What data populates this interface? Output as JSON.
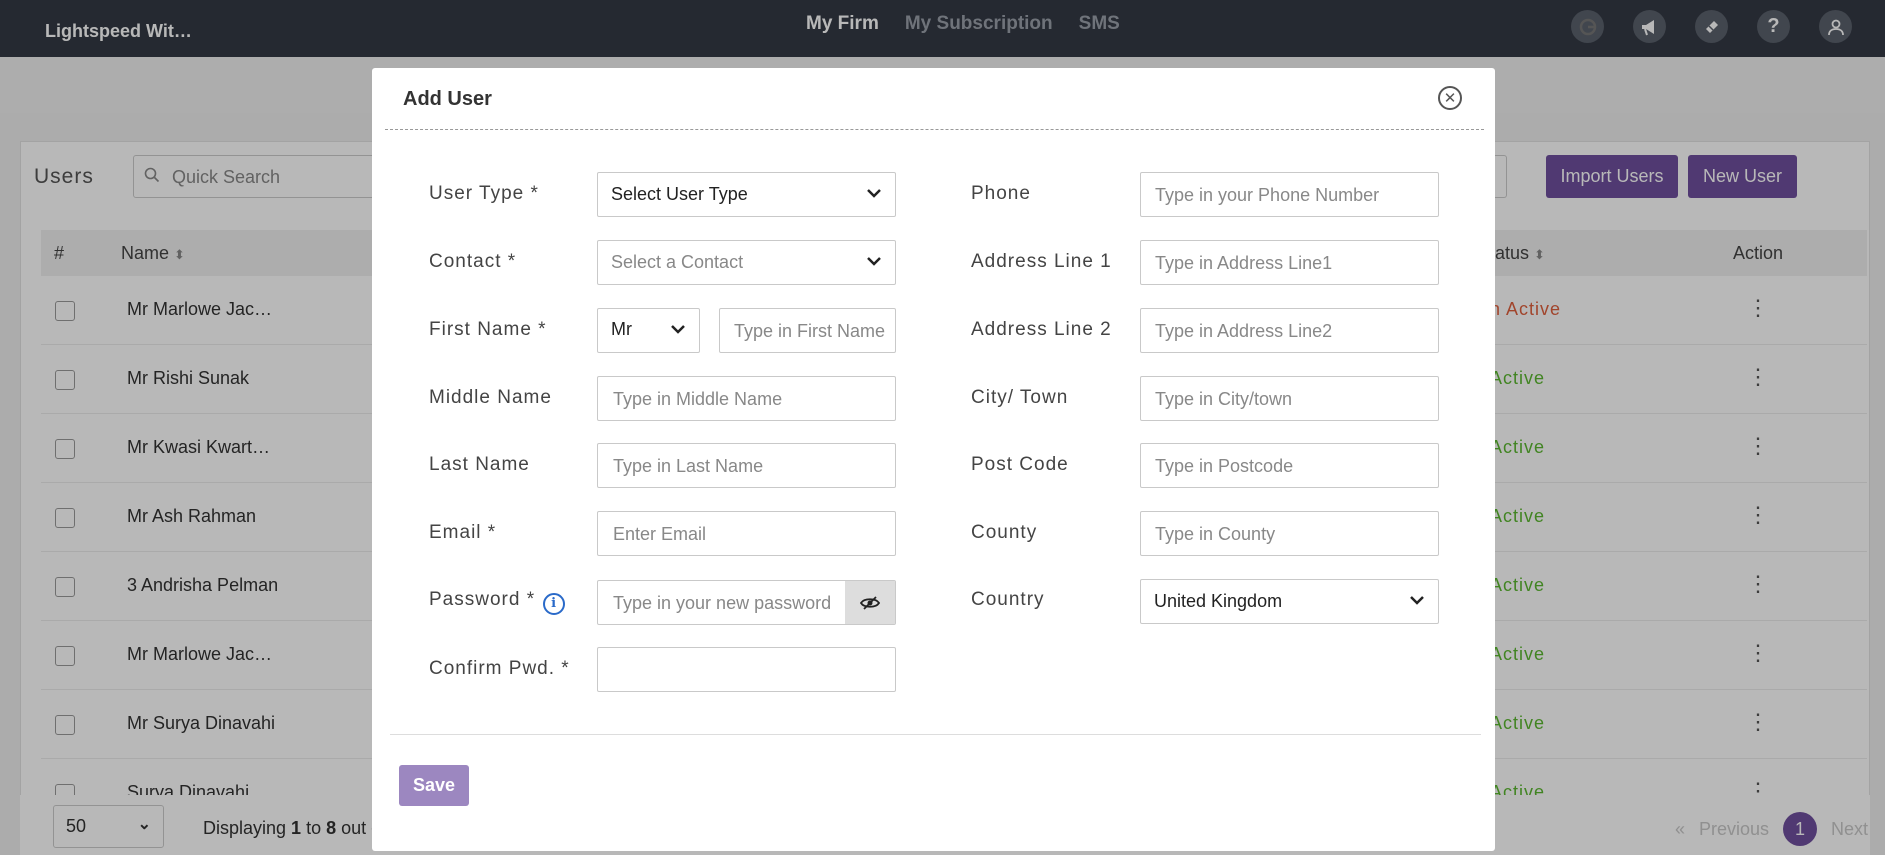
{
  "topbar": {
    "brand": "Lightspeed Wit…",
    "nav": [
      "My Firm",
      "My Subscription",
      "SMS"
    ],
    "icons": [
      "google-icon",
      "megaphone-icon",
      "ticket-icon",
      "help-icon",
      "user-icon"
    ]
  },
  "users_page": {
    "title": "Users",
    "search_placeholder": "Quick Search",
    "import_button": "Import Users",
    "new_button": "New User",
    "columns": {
      "num": "#",
      "name": "Name",
      "status": "tatus",
      "action": "Action"
    },
    "rows": [
      {
        "name": "Mr Marlowe Jac…",
        "status": "n Active",
        "status_color": "#e0603e"
      },
      {
        "name": "Mr Rishi Sunak",
        "status": "Active",
        "status_color": "#5bb830"
      },
      {
        "name": "Mr Kwasi Kwart…",
        "status": "Active",
        "status_color": "#5bb830"
      },
      {
        "name": "Mr Ash Rahman",
        "status": "Active",
        "status_color": "#5bb830"
      },
      {
        "name": "3 Andrisha Pelman",
        "status": "Active",
        "status_color": "#5bb830"
      },
      {
        "name": "Mr Marlowe Jac…",
        "status": "Active",
        "status_color": "#5bb830"
      },
      {
        "name": "Mr Surya Dinavahi",
        "status": "Active",
        "status_color": "#5bb830"
      },
      {
        "name": "Surya Dinavahi",
        "status": "Active",
        "status_color": "#5bb830"
      }
    ],
    "page_size": "50",
    "displaying": {
      "prefix": "Displaying ",
      "from": "1",
      "mid": " to ",
      "to": "8",
      "suffix": " out o"
    },
    "pager": {
      "first": "«",
      "previous": "Previous",
      "current": "1",
      "next": "Next"
    }
  },
  "modal": {
    "title": "Add User",
    "left_fields": {
      "user_type": {
        "label": "User Type *",
        "value": "Select User Type"
      },
      "contact": {
        "label": "Contact *",
        "placeholder": "Select a Contact"
      },
      "first_name": {
        "label": "First Name *",
        "title_value": "Mr",
        "placeholder": "Type in First Name"
      },
      "middle_name": {
        "label": "Middle Name",
        "placeholder": "Type in Middle Name"
      },
      "last_name": {
        "label": "Last Name",
        "placeholder": "Type in Last Name"
      },
      "email": {
        "label": "Email *",
        "placeholder": "Enter Email"
      },
      "password": {
        "label": "Password *",
        "placeholder": "Type in your new password"
      },
      "confirm": {
        "label": "Confirm Pwd. *",
        "placeholder": ""
      }
    },
    "right_fields": {
      "phone": {
        "label": "Phone",
        "placeholder": "Type in your Phone Number"
      },
      "address1": {
        "label": "Address Line 1",
        "placeholder": "Type in Address Line1"
      },
      "address2": {
        "label": "Address Line 2",
        "placeholder": "Type in Address Line2"
      },
      "city": {
        "label": "City/ Town",
        "placeholder": "Type in City/town"
      },
      "postcode": {
        "label": "Post Code",
        "placeholder": "Type in Postcode"
      },
      "county": {
        "label": "County",
        "placeholder": "Type in County"
      },
      "country": {
        "label": "Country",
        "value": "United Kingdom"
      }
    },
    "save_label": "Save",
    "accent_color": "#6f4f9f"
  }
}
